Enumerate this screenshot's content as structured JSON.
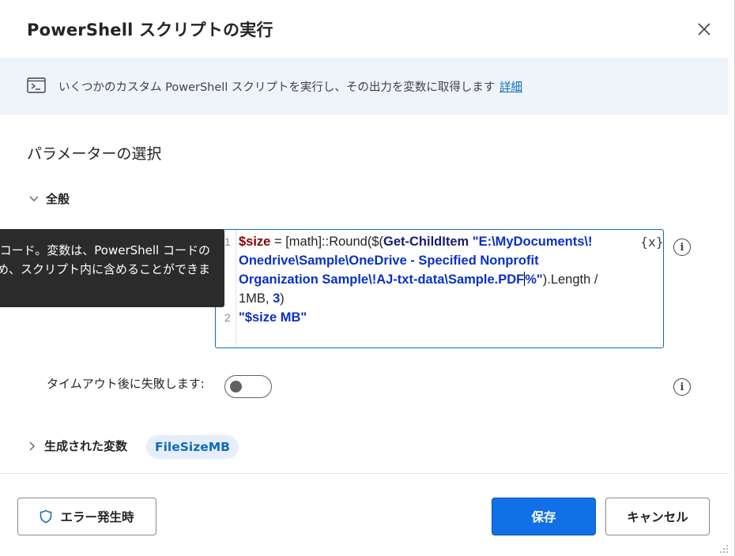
{
  "dialog": {
    "title": "PowerShell スクリプトの実行",
    "close_icon": "close-icon"
  },
  "info_bar": {
    "icon": "powershell-icon",
    "text": "いくつかのカスタム PowerShell スクリプトを実行し、その出力を変数に取得します",
    "link": "詳細"
  },
  "parameters": {
    "section_title": "パラメーターの選択",
    "general_label": "全般"
  },
  "tooltip": {
    "line1": "ll コード。変数は、PowerShell コードの",
    "line2": "ため、スクリプト内に含めることができま"
  },
  "code_editor": {
    "line_numbers": [
      "1",
      "2"
    ],
    "line1_var": "$size",
    "line1_eq": " = ",
    "line1_math": "[math]::Round($(",
    "line1_cmd": "Get-ChildItem",
    "line1_str_a": " \"E:\\MyDocuments\\!",
    "line1_str_b": "Onedrive\\Sample\\OneDrive - Specified Nonprofit",
    "line1_str_c": "Organization Sample\\!AJ-txt-data\\Sample.PDF",
    "line1_str_d": "%\"",
    "line1_tail_a": ").Length /",
    "line1_tail_b": "1MB, ",
    "line1_num": "3",
    "line1_tail_c": ")",
    "line2": "\"$size MB\"",
    "variable_button": "{x}"
  },
  "timeout": {
    "label": "タイムアウト後に失敗します:",
    "enabled": false
  },
  "generated_variables": {
    "label": "生成された変数",
    "chip": "FileSizeMB"
  },
  "footer": {
    "on_error_label": "エラー発生時",
    "save_label": "保存",
    "cancel_label": "キャンセル"
  },
  "colors": {
    "accent": "#1170e8",
    "info_bar_bg": "#eff4fb",
    "link": "#0f6cbd",
    "variable": "#8b0000",
    "string": "#0a30c8"
  }
}
